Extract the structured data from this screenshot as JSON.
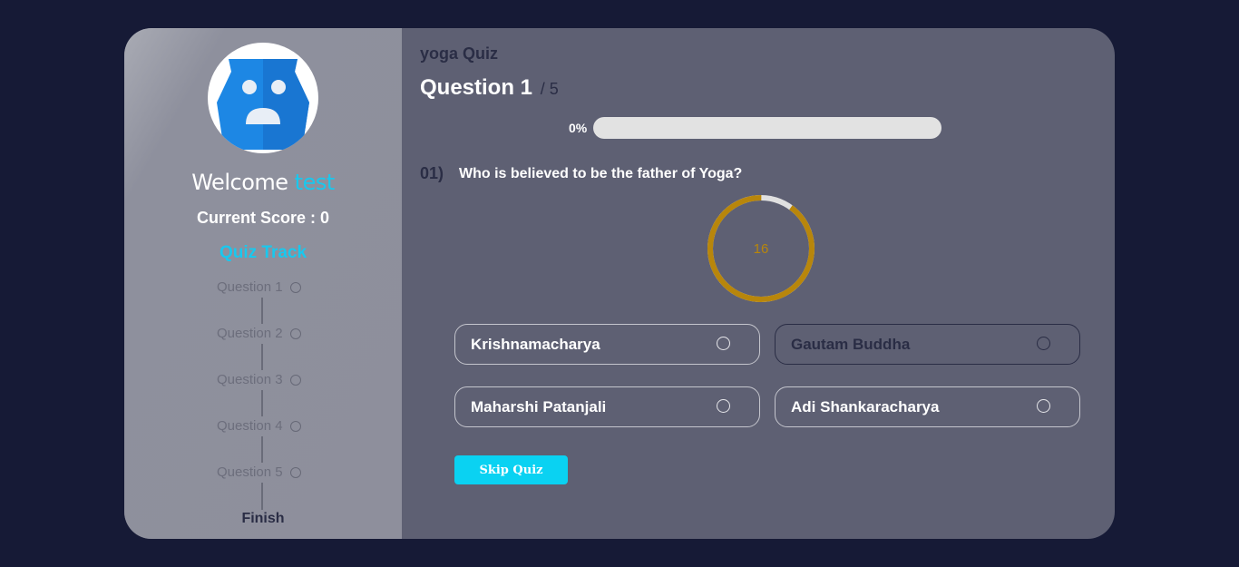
{
  "sidebar": {
    "welcome_text": "Welcome",
    "username": "test",
    "score_label": "Current Score : ",
    "score_value": "0",
    "track_title": "Quiz Track",
    "track_items": [
      "Question 1",
      "Question 2",
      "Question 3",
      "Question 4",
      "Question 5"
    ],
    "finish_label": "Finish"
  },
  "quiz": {
    "title": "yoga Quiz",
    "question_label": "Question 1",
    "question_total": "/ 5",
    "progress_label": "0%",
    "progress_percent": 0,
    "question_number": "01)",
    "question_text": "Who is believed to be the father of Yoga?",
    "timer_value": "16",
    "timer_fraction_remaining": 0.9,
    "options": [
      "Krishnamacharya",
      "Gautam Buddha",
      "Maharshi Patanjali",
      "Adi Shankaracharya"
    ],
    "skip_label": "Skip Quiz"
  },
  "colors": {
    "background": "#161a36",
    "accent": "#19c8ee",
    "timer_ring": "#b8860b",
    "timer_track": "#e0e0e0"
  },
  "icons": {
    "avatar": "sad-robot-face-icon",
    "track_marker": "circle-outline-icon",
    "option_marker": "radio-circle-icon"
  }
}
